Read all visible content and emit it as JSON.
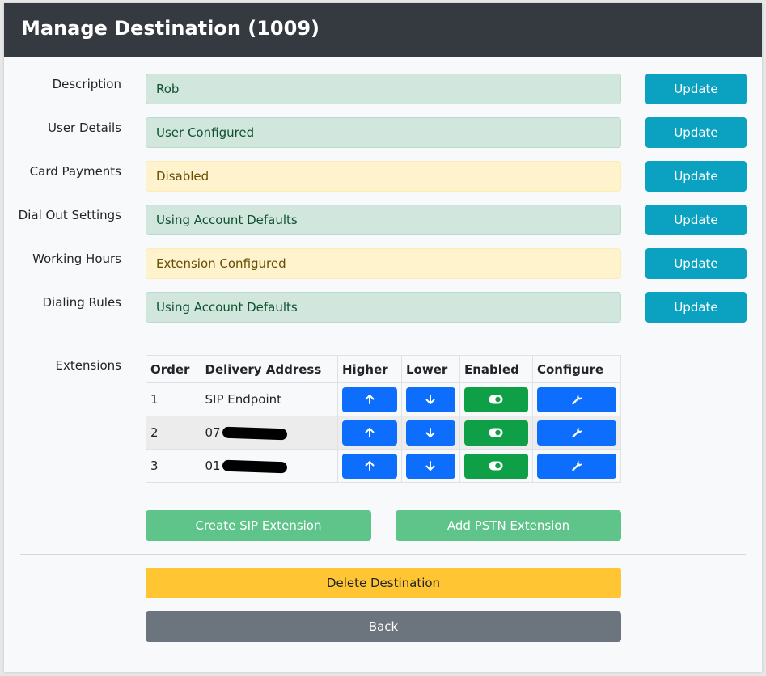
{
  "page": {
    "title": "Manage Destination (1009)"
  },
  "fields": [
    {
      "label": "Description",
      "value": "Rob",
      "status": "success",
      "button": "Update"
    },
    {
      "label": "User Details",
      "value": "User Configured",
      "status": "success",
      "button": "Update"
    },
    {
      "label": "Card Payments",
      "value": "Disabled",
      "status": "warning",
      "button": "Update"
    },
    {
      "label": "Dial Out Settings",
      "value": "Using Account Defaults",
      "status": "success",
      "button": "Update"
    },
    {
      "label": "Working Hours",
      "value": "Extension Configured",
      "status": "warning",
      "button": "Update"
    },
    {
      "label": "Dialing Rules",
      "value": "Using Account Defaults",
      "status": "success",
      "button": "Update"
    }
  ],
  "extensions": {
    "label": "Extensions",
    "columns": [
      "Order",
      "Delivery Address",
      "Higher",
      "Lower",
      "Enabled",
      "Configure"
    ],
    "rows": [
      {
        "order": "1",
        "address": "SIP Endpoint",
        "redacted": false,
        "enabled": true
      },
      {
        "order": "2",
        "address": "07",
        "redacted": true,
        "enabled": true
      },
      {
        "order": "3",
        "address": "01",
        "redacted": true,
        "enabled": true
      }
    ],
    "icons": {
      "higher": "arrow-up-icon",
      "lower": "arrow-down-icon",
      "enabled": "toggle-on-icon",
      "configure": "wrench-icon"
    }
  },
  "actions": {
    "create_sip": "Create SIP Extension",
    "add_pstn": "Add PSTN Extension",
    "delete": "Delete Destination",
    "back": "Back"
  },
  "colors": {
    "header": "#343a40",
    "update": "#0aa2c0",
    "success_bg": "#d1e7dd",
    "warning_bg": "#fff3cd",
    "primary": "#0d6efd",
    "enabled": "#0e9f47",
    "delete": "#ffc533",
    "back": "#6c757d"
  }
}
